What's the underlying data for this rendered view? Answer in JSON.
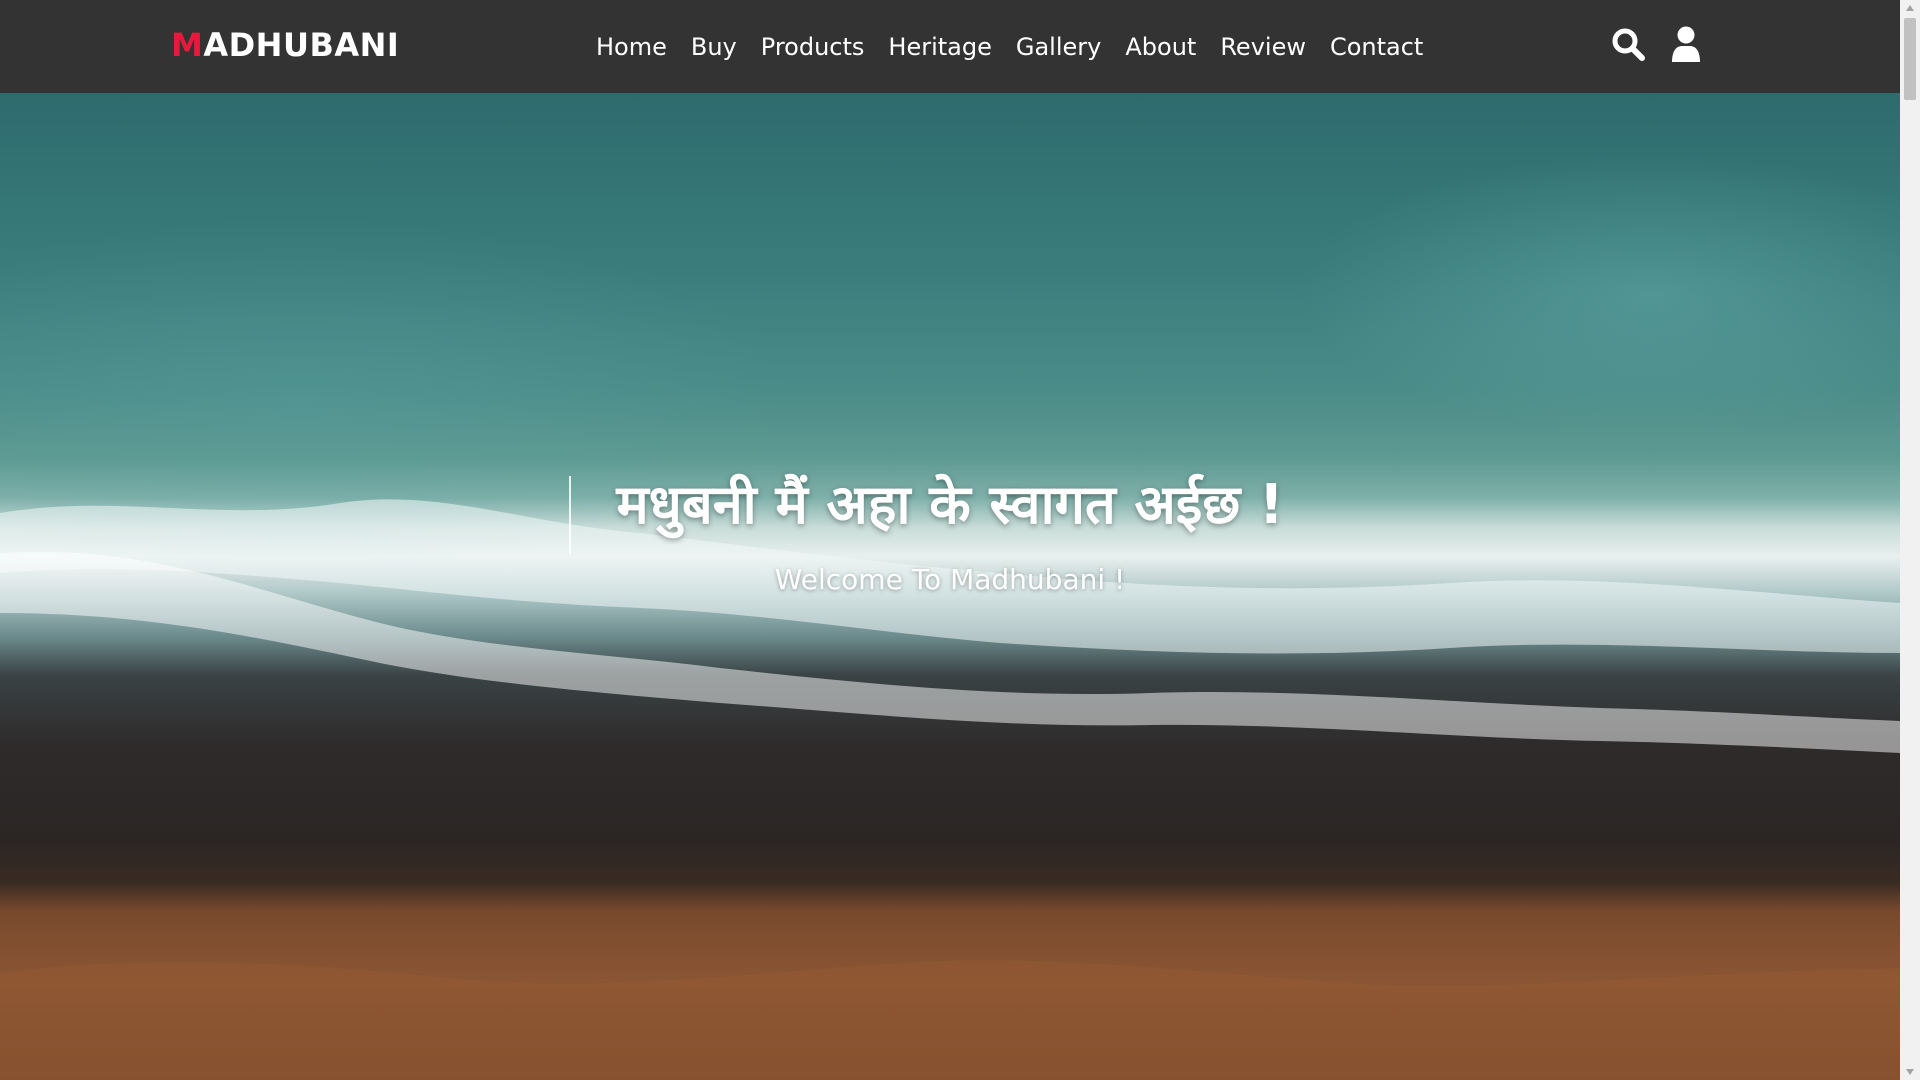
{
  "brand": {
    "accent_letter": "M",
    "rest": "ADHUBANI",
    "accent_color": "#e8193c"
  },
  "nav": {
    "links": [
      "Home",
      "Buy",
      "Products",
      "Heritage",
      "Gallery",
      "About",
      "Review",
      "Contact"
    ],
    "icons": [
      "search-icon",
      "user-icon"
    ]
  },
  "hero": {
    "title": "मधुबनी मैं अहा के स्वागत अईछ !",
    "subtitle": "Welcome To Madhubani !",
    "background": "aerial-ocean-waves-beach-video"
  },
  "colors": {
    "navbar_bg": "#333333",
    "text": "#ffffff"
  }
}
